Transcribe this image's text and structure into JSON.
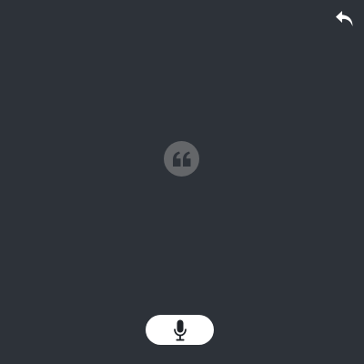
{
  "app": {
    "background_color": "#2d3239",
    "accent_icon_color": "#ffffff"
  },
  "toolbar": {
    "back_icon": "undo-arrow-icon"
  },
  "placeholder": {
    "icon": "quote-icon",
    "badge_color": "#646669"
  },
  "voice_input": {
    "icon": "microphone-icon",
    "button_color": "#ffffff",
    "icon_color": "#1f2328"
  }
}
